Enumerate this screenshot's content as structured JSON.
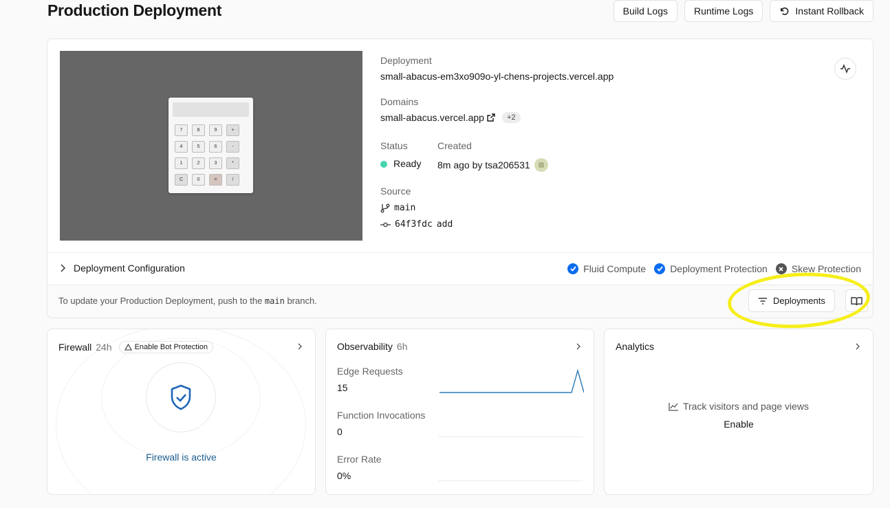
{
  "page": {
    "title": "Production Deployment"
  },
  "actions": {
    "build_logs": "Build Logs",
    "runtime_logs": "Runtime Logs",
    "instant_rollback": "Instant Rollback"
  },
  "preview": {
    "calculator_keys": [
      "7",
      "8",
      "9",
      "+",
      "4",
      "5",
      "6",
      "-",
      "1",
      "2",
      "3",
      "*",
      "C",
      "0",
      "=",
      "/"
    ]
  },
  "deployment": {
    "label": "Deployment",
    "url": "small-abacus-em3xo909o-yl-chens-projects.vercel.app",
    "domains_label": "Domains",
    "domain": "small-abacus.vercel.app",
    "domains_extra": "+2",
    "status_label": "Status",
    "status": "Ready",
    "status_color": "#46d4b0",
    "created_label": "Created",
    "created": "8m ago by tsa206531",
    "source_label": "Source",
    "branch": "main",
    "commit_hash": "64f3fdc",
    "commit_message": "add"
  },
  "config": {
    "title": "Deployment Configuration",
    "features": [
      {
        "label": "Fluid Compute",
        "enabled": true
      },
      {
        "label": "Deployment Protection",
        "enabled": true
      },
      {
        "label": "Skew Protection",
        "enabled": false
      }
    ]
  },
  "footer": {
    "note_prefix": "To update your Production Deployment, push to the ",
    "note_branch": "main",
    "note_suffix": " branch.",
    "deployments_button": "Deployments"
  },
  "firewall": {
    "title": "Firewall",
    "period": "24h",
    "bot_badge": "Enable Bot Protection",
    "status": "Firewall is active"
  },
  "observability": {
    "title": "Observability",
    "period": "6h",
    "metrics": [
      {
        "label": "Edge Requests",
        "value": "15"
      },
      {
        "label": "Function Invocations",
        "value": "0"
      },
      {
        "label": "Error Rate",
        "value": "0%"
      }
    ]
  },
  "analytics": {
    "title": "Analytics",
    "track_text": "Track visitors and page views",
    "enable": "Enable"
  },
  "colors": {
    "accent_blue": "#0a6cf0",
    "highlight_yellow": "#f6ee1a",
    "chart_line": "#2d7bb8"
  }
}
